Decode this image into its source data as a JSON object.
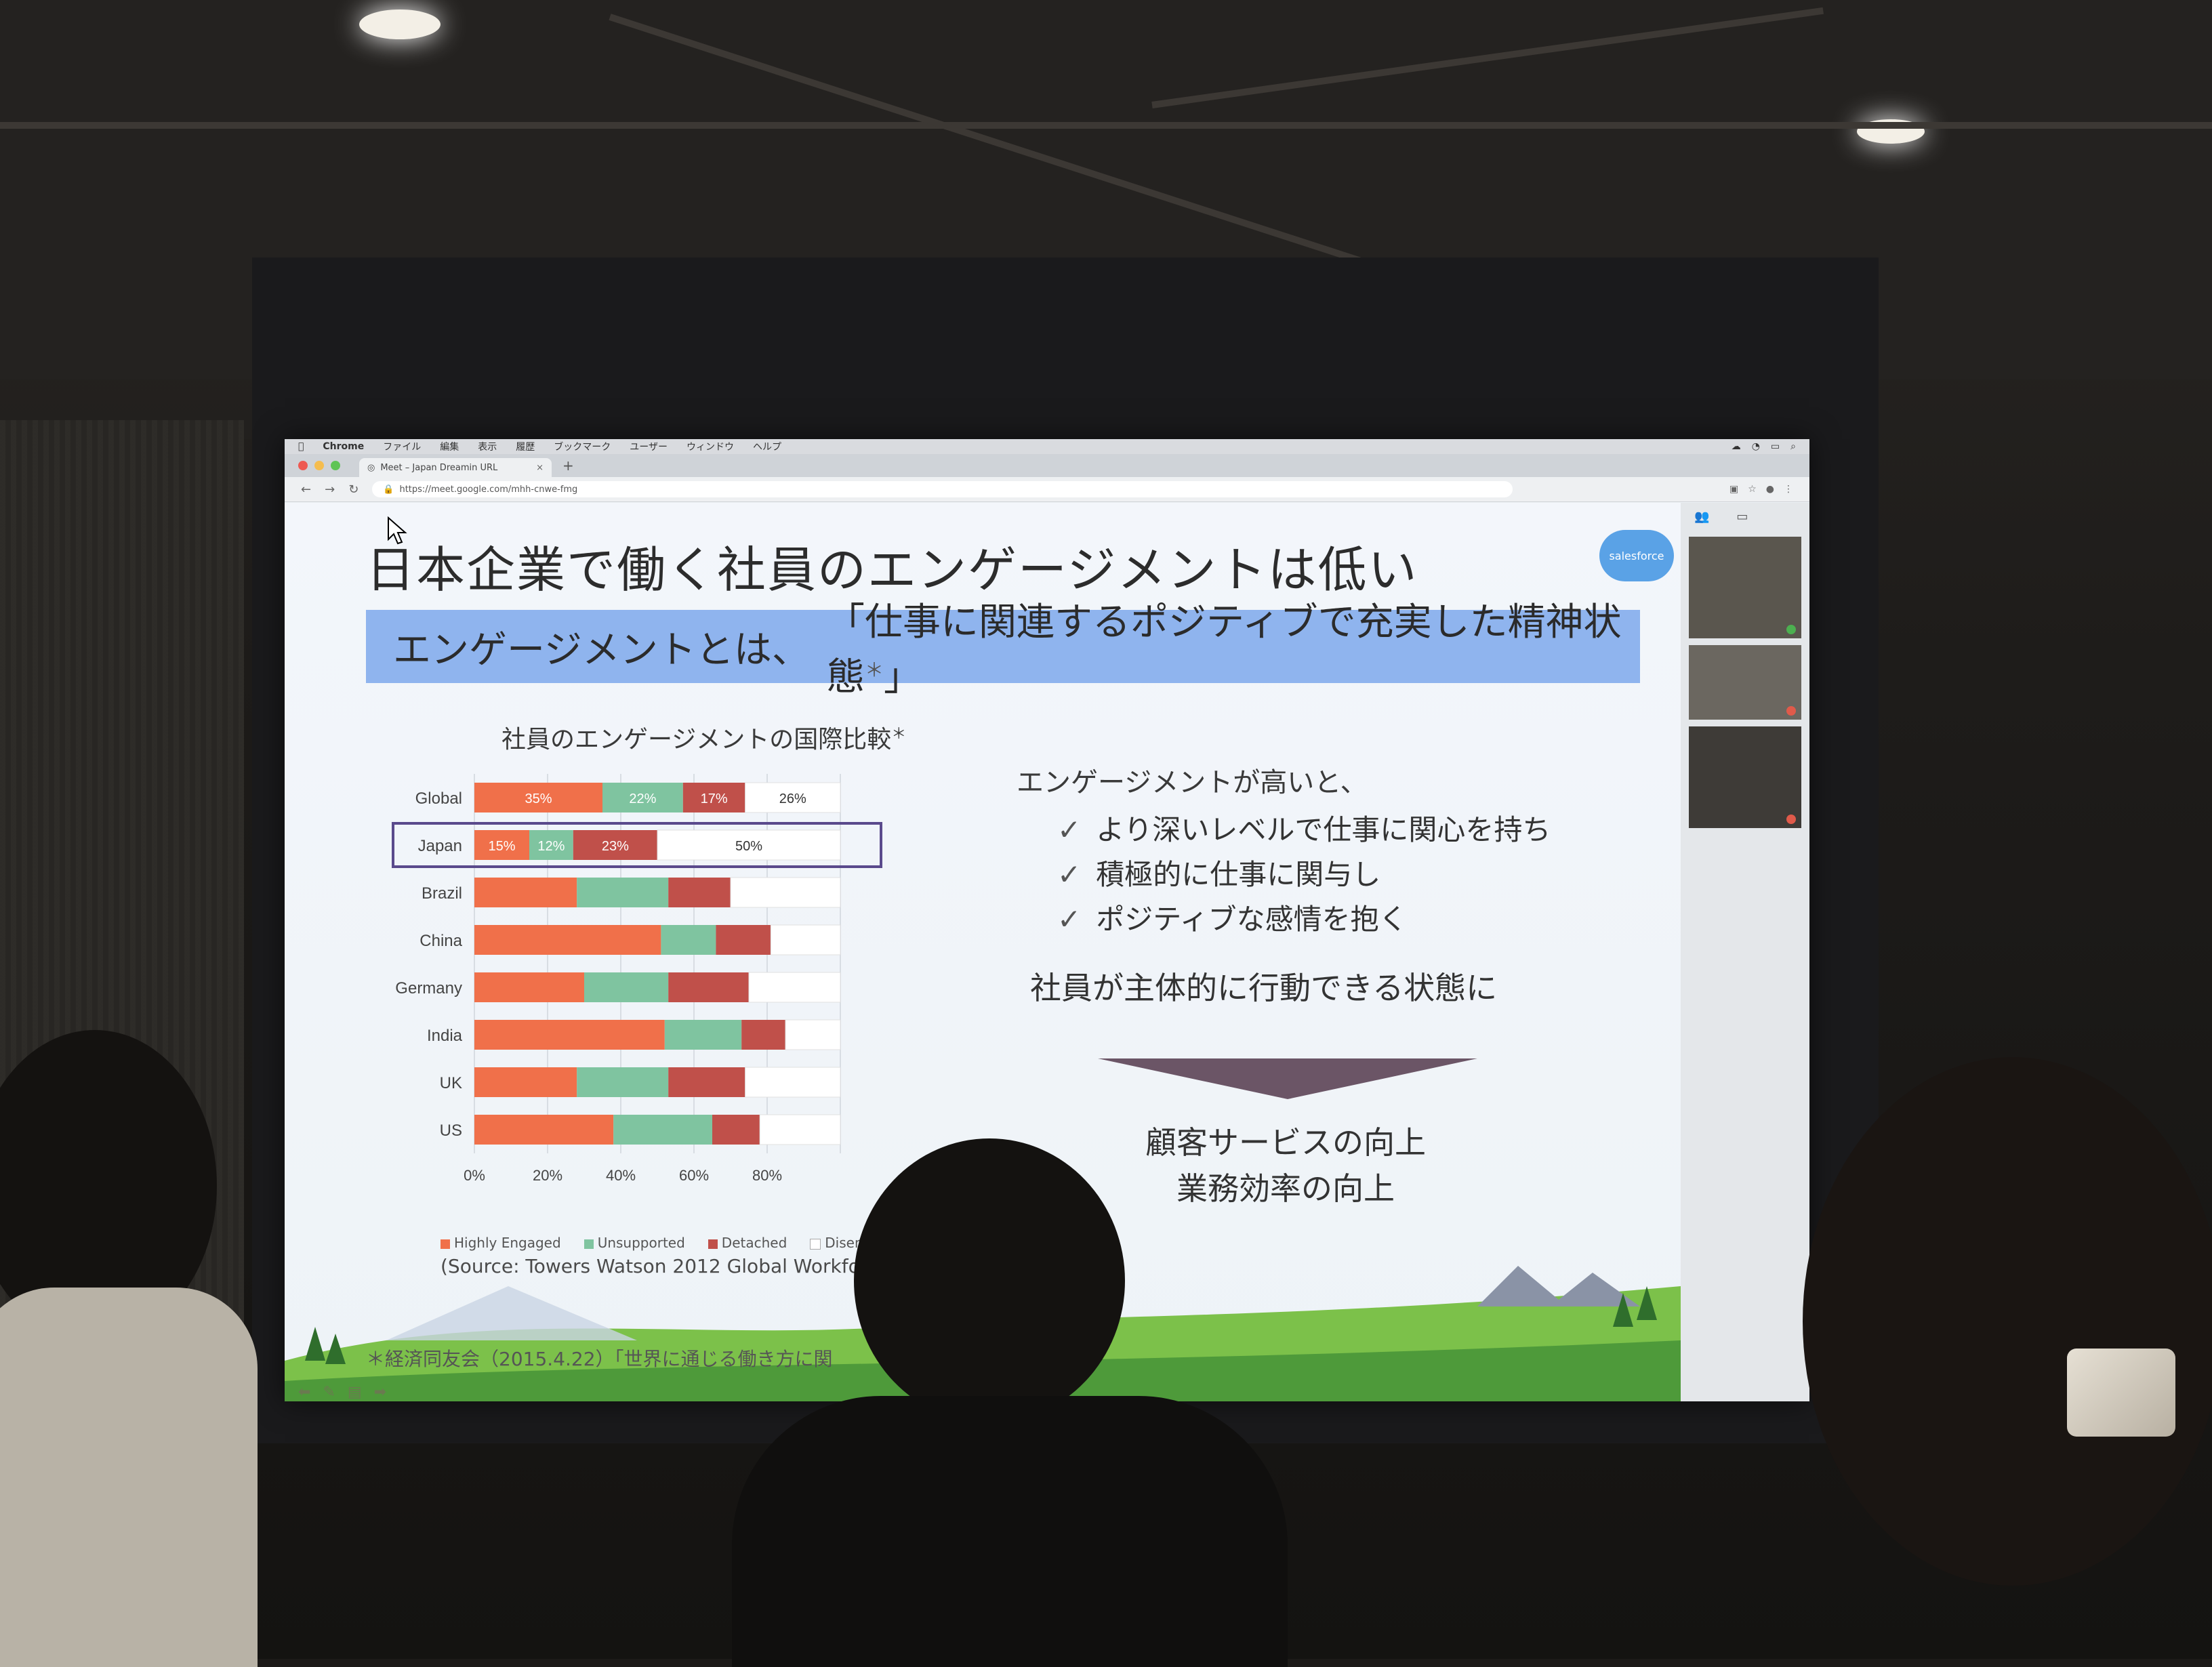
{
  "browser": {
    "menubar": [
      "Chrome",
      "ファイル",
      "編集",
      "表示",
      "履歴",
      "ブックマーク",
      "ユーザー",
      "ウィンドウ",
      "ヘルプ"
    ],
    "tab_title": "Meet – Japan Dreamin URL",
    "url": "https://meet.google.com/mhh-cnwe-fmg"
  },
  "slide": {
    "title": "日本企業で働く社員のエンゲージメントは低い",
    "definition_term": "エンゲージメントとは、",
    "definition_text": "「仕事に関連するポジティブで充実した精神状態",
    "definition_mark": "＊",
    "definition_close": "」",
    "logo": "salesforce",
    "chart_title": "社員のエンゲージメントの国際比較",
    "chart_title_mark": "＊",
    "source": "(Source: Towers Watson 2012 Global Workforc",
    "rhs_intro": "エンゲージメントが高いと、",
    "checklist": [
      "より深いレベルで仕事に関心を持ち",
      "積極的に仕事に関与し",
      "ポジティブな感情を抱く"
    ],
    "state": "社員が主体的に行動できる状態に",
    "outcomes": [
      "顧客サービスの向上",
      "業務効率の向上"
    ],
    "footnote": "＊経済同友会（2015.4.22）「世界に通じる働き方に関"
  },
  "chart_data": {
    "type": "bar",
    "orientation": "horizontal",
    "stacked": true,
    "categories": [
      "Global",
      "Japan",
      "Brazil",
      "China",
      "Germany",
      "India",
      "UK",
      "US"
    ],
    "series": [
      {
        "name": "Highly Engaged",
        "color": "#f0704a",
        "values": [
          35,
          15,
          28,
          51,
          30,
          52,
          28,
          38
        ]
      },
      {
        "name": "Unsupported",
        "color": "#7fc4a0",
        "values": [
          22,
          12,
          25,
          15,
          23,
          21,
          25,
          27
        ]
      },
      {
        "name": "Detached",
        "color": "#c0504a",
        "values": [
          17,
          23,
          17,
          15,
          22,
          12,
          21,
          13
        ]
      },
      {
        "name": "Disengaged",
        "color": "#ffffff",
        "values": [
          26,
          50,
          30,
          19,
          25,
          15,
          26,
          22
        ]
      }
    ],
    "data_labels": {
      "Global": [
        "35%",
        "22%",
        "17%",
        "26%"
      ],
      "Japan": [
        "15%",
        "12%",
        "23%",
        "50%"
      ]
    },
    "highlighted_category": "Japan",
    "legend_labels": [
      "Highly Engaged",
      "Unsupported",
      "Detached",
      "Disen"
    ],
    "x_ticks": [
      "0%",
      "20%",
      "40%",
      "60%",
      "80%"
    ],
    "xlim": [
      0,
      100
    ],
    "legend_position": "bottom"
  }
}
